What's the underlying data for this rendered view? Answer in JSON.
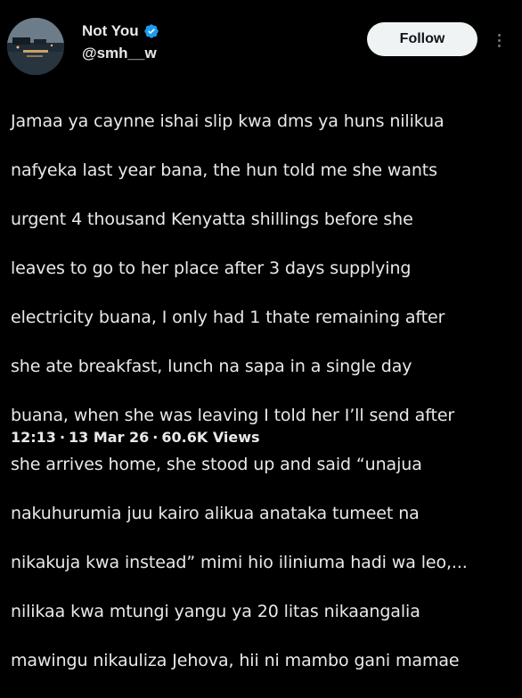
{
  "author": {
    "display_name": "Not You",
    "handle": "@smh__w",
    "verified": true,
    "avatar_icon": "avatar-night-water-scene"
  },
  "actions": {
    "follow_label": "Follow",
    "more_icon": "more-vertical-icon"
  },
  "post": {
    "lines": [
      "Jamaa ya caynne ishai slip kwa dms ya huns nilikua",
      "nafyeka last year bana, the hun told me she wants",
      "urgent 4 thousand Kenyatta shillings before she",
      "leaves to go to her place after 3 days supplying",
      "electricity buana, I only had 1 thate remaining after",
      "she ate breakfast, lunch na sapa in a single day",
      "buana, when she was leaving I told her I’ll send after",
      "she arrives home, she stood up and said “unajua",
      "nakuhurumia juu kairo alikua anataka tumeet na",
      "nikakuja kwa instead” mimi hio iliniuma hadi wa leo,...",
      "nilikaa kwa mtungi yangu ya 20 litas nikaangalia",
      "mawingu nikauliza Jehova, hii ni mambo gani mamae"
    ]
  },
  "meta": {
    "time": "12:13",
    "separator": "·",
    "date": "13 Mar 26",
    "views": "60.6K Views"
  },
  "colors": {
    "background": "#000000",
    "text": "#e7e9ea",
    "verified_badge": "#1d9bf0",
    "follow_bg": "#eff3f4",
    "follow_text": "#0f1419"
  }
}
